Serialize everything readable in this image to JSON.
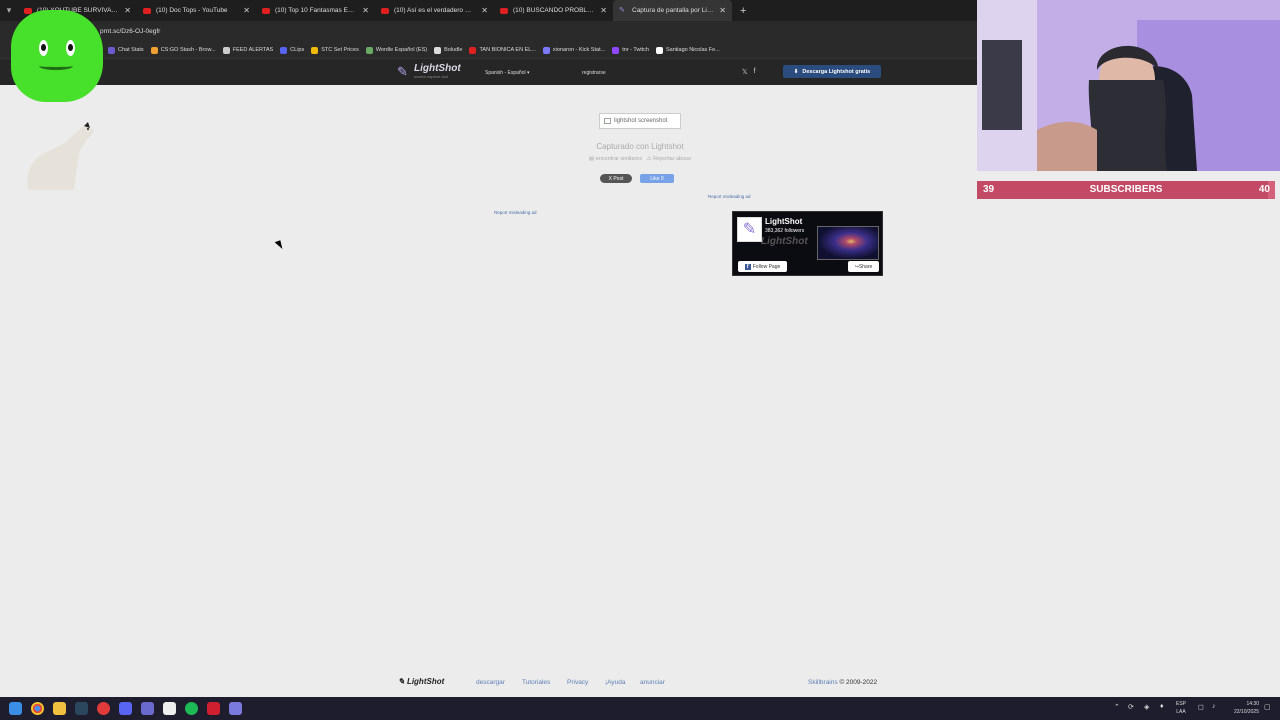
{
  "browser": {
    "tabs": [
      {
        "title": "(10) YOUTUBE SURVIVAL GAMES",
        "favicon": "youtube-icon"
      },
      {
        "title": "(10) Doc Tops - YouTube",
        "favicon": "youtube-icon"
      },
      {
        "title": "(10) Top 10 Fantasmas ESCALOFRIANTES",
        "favicon": "youtube-icon"
      },
      {
        "title": "(10) Así es el verdadero mundo",
        "favicon": "youtube-icon"
      },
      {
        "title": "(10) BUSCANDO PROBLEMAS",
        "favicon": "youtube-icon"
      },
      {
        "title": "Captura de pantalla por Lightshot",
        "favicon": "lightshot-icon",
        "active": true
      }
    ],
    "new_tab": "+",
    "address": "prnt.sc/Dz6-OJ-0egfr",
    "bookmarks": [
      {
        "label": "Chat Stats",
        "color": "#6a5acd"
      },
      {
        "label": "CS:GO Stash - Brow...",
        "color": "#f0a030"
      },
      {
        "label": "FEED ALERTAS",
        "color": "#cccccc"
      },
      {
        "label": "CLips",
        "color": "#5865f2"
      },
      {
        "label": "STC Set Prices",
        "color": "#f0b90b"
      },
      {
        "label": "Wordle Español (ES)",
        "color": "#6aaa64"
      },
      {
        "label": "Boludle",
        "color": "#dddddd"
      },
      {
        "label": "TAN BIONICA EN EL...",
        "color": "#e02020"
      },
      {
        "label": "xionaron - Kick Stat...",
        "color": "#7a7aff"
      },
      {
        "label": "tnr - Twitch",
        "color": "#9146ff"
      },
      {
        "label": "Santiago Nicolas Fe...",
        "color": "#ffffff"
      }
    ]
  },
  "lightshot": {
    "logo": "LightShot",
    "logo_sub": "screen capture tool",
    "language": "Spanish - Español",
    "register": "registrarse",
    "download_button": "Descarga Lightshot gratis",
    "screenshot_alt": "lightshot screenshot",
    "captured_with": "Capturado con Lightshot",
    "find_similar": "encontrar similares",
    "report_abuse": "Reportar abuso",
    "post_button": "X Post",
    "like_button": "Like 0",
    "report_ad_left": "Report misleading ad",
    "report_ad_right": "Report misleading ad",
    "fb": {
      "name": "LightShot",
      "followers": "383,362 followers",
      "follow_button": "Follow Page",
      "share_button": "Share"
    },
    "footer": {
      "logo": "LightShot",
      "links": [
        "descargar",
        "Tutoriales",
        "Privacy",
        "¡Ayuda",
        "anunciar"
      ],
      "company": "Skillbrains",
      "copyright": "© 2009-2022"
    }
  },
  "stream": {
    "subscribers": {
      "current": "39",
      "label": "SUBSCRIBERS",
      "goal": "40",
      "progress": 0.975
    }
  },
  "taskbar": {
    "language": "ESP",
    "language_sub": "LAA",
    "time": "14:30",
    "date": "22/10/2025"
  }
}
